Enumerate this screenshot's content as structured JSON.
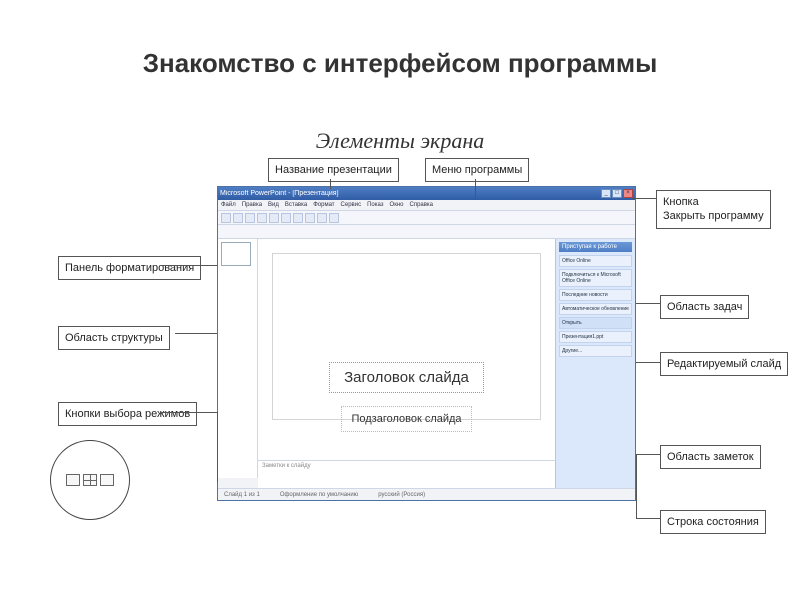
{
  "page": {
    "title": "Знакомство с интерфейсом программы",
    "subtitle": "Элементы экрана"
  },
  "labels": {
    "presentation_title": "Название презентации",
    "program_menu": "Меню программы",
    "close_button": "Кнопка\nЗакрыть программу",
    "task_pane": "Область задач",
    "editable_slide": "Редактируемый слайд",
    "notes_area": "Область заметок",
    "status_bar": "Строка состояния",
    "view_buttons": "Кнопки выбора режимов",
    "outline_area": "Область структуры",
    "formatting_panel": "Панель форматирования"
  },
  "app": {
    "titlebar": "Microsoft PowerPoint - [Презентация]",
    "menus": [
      "Файл",
      "Правка",
      "Вид",
      "Вставка",
      "Формат",
      "Сервис",
      "Показ",
      "Окно",
      "Справка"
    ],
    "slide": {
      "title_placeholder": "Заголовок слайда",
      "subtitle_placeholder": "Подзаголовок слайда"
    },
    "notes_placeholder": "Заметки к слайду",
    "taskpane": {
      "header": "Приступая к работе",
      "brand": "Office Online",
      "links": [
        "Подключиться к Microsoft Office Online",
        "Последние новости",
        "Автоматическое обновление"
      ],
      "open": "Открыть",
      "recent": [
        "Презентация1.ppt",
        "Другие..."
      ]
    },
    "status": {
      "slide": "Слайд 1 из 1",
      "template": "Оформление по умолчанию",
      "lang": "русский (Россия)"
    }
  }
}
